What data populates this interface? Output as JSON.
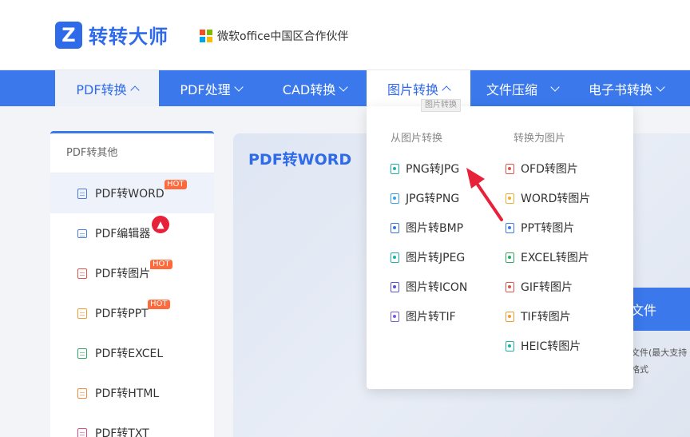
{
  "header": {
    "logo_mark": "Z",
    "logo_text": "转转大师",
    "partner_text": "微软office中国区合作伙伴"
  },
  "nav": {
    "items": [
      {
        "label": "PDF转换",
        "state": "active",
        "chevron": "up"
      },
      {
        "label": "PDF处理",
        "state": "normal",
        "chevron": "down"
      },
      {
        "label": "CAD转换",
        "state": "normal",
        "chevron": "down"
      },
      {
        "label": "图片转换",
        "state": "hover",
        "chevron": "up"
      },
      {
        "label": "文件压缩",
        "state": "normal",
        "chevron": "down"
      },
      {
        "label": "电子书转换",
        "state": "normal",
        "chevron": "down"
      }
    ],
    "tooltip": "图片转换"
  },
  "sidebar": {
    "heading": "PDF转其他",
    "items": [
      {
        "label": "PDF转WORD",
        "badge": "HOT",
        "active": true,
        "icon": "word-file-icon",
        "icon_color": "#4a7be0"
      },
      {
        "label": "PDF编辑器",
        "badge": "fire",
        "active": false,
        "icon": "monitor-icon",
        "icon_color": "#4a7be0"
      },
      {
        "label": "PDF转图片",
        "badge": "HOT",
        "active": false,
        "icon": "image-file-icon",
        "icon_color": "#e0534a"
      },
      {
        "label": "PDF转PPT",
        "badge": "HOT",
        "active": false,
        "icon": "ppt-file-icon",
        "icon_color": "#f29a2e"
      },
      {
        "label": "PDF转EXCEL",
        "badge": "",
        "active": false,
        "icon": "excel-file-icon",
        "icon_color": "#2fa866"
      },
      {
        "label": "PDF转HTML",
        "badge": "",
        "active": false,
        "icon": "html-file-icon",
        "icon_color": "#f28a3e"
      },
      {
        "label": "PDF转TXT",
        "badge": "",
        "active": false,
        "icon": "txt-file-icon",
        "icon_color": "#d64a8a"
      }
    ]
  },
  "main": {
    "title": "PDF转WORD",
    "upload_label": "文件",
    "note_line1": "文件(最大支持",
    "note_line2": "格式"
  },
  "dropdown": {
    "col1_title": "从图片转换",
    "col2_title": "转换为图片",
    "col1": [
      {
        "label": "PNG转JPG",
        "icon": "png-file-icon",
        "color": "#1db3a4"
      },
      {
        "label": "JPG转PNG",
        "icon": "jpg-file-icon",
        "color": "#3aa0e8"
      },
      {
        "label": "图片转BMP",
        "icon": "bmp-file-icon",
        "color": "#3a6fe0"
      },
      {
        "label": "图片转JPEG",
        "icon": "jpeg-file-icon",
        "color": "#1db3a4"
      },
      {
        "label": "图片转ICON",
        "icon": "icon-file-icon",
        "color": "#5a4fd6"
      },
      {
        "label": "图片转TIF",
        "icon": "tif-file-icon",
        "color": "#7a5cd6"
      }
    ],
    "col2": [
      {
        "label": "OFD转图片",
        "icon": "ofd-file-icon",
        "color": "#e0534a"
      },
      {
        "label": "WORD转图片",
        "icon": "word-file-icon",
        "color": "#e8b02e"
      },
      {
        "label": "PPT转图片",
        "icon": "ppt-file-icon",
        "color": "#3a78ec"
      },
      {
        "label": "EXCEL转图片",
        "icon": "excel-file-icon",
        "color": "#2fa866"
      },
      {
        "label": "GIF转图片",
        "icon": "gif-file-icon",
        "color": "#e0534a"
      },
      {
        "label": "TIF转图片",
        "icon": "tif-file-icon",
        "color": "#f29a2e"
      },
      {
        "label": "HEIC转图片",
        "icon": "heic-file-icon",
        "color": "#1db3a4"
      }
    ]
  },
  "colors": {
    "brand": "#2f6ae9",
    "nav_bg": "#3a78ec",
    "hot_badge": "#ff6a3d",
    "arrow": "#e8213a"
  }
}
